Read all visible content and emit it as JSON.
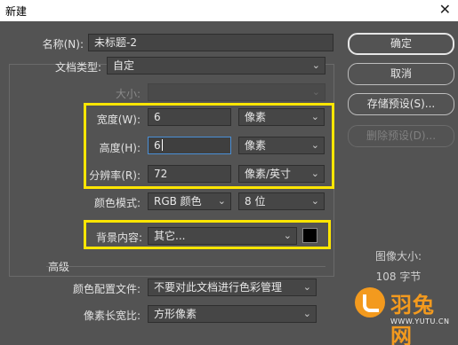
{
  "window": {
    "title": "新建",
    "close_glyph": "✕"
  },
  "form": {
    "name_label": "名称(N):",
    "name_value": "未标题-2",
    "doc_type_label": "文档类型:",
    "doc_type_value": "自定",
    "size_label": "大小:",
    "size_value": "",
    "width_label": "宽度(W):",
    "width_value": "6",
    "width_unit": "像素",
    "height_label": "高度(H):",
    "height_value": "6",
    "height_unit": "像素",
    "resolution_label": "分辨率(R):",
    "resolution_value": "72",
    "resolution_unit": "像素/英寸",
    "color_mode_label": "颜色模式:",
    "color_mode_value": "RGB 颜色",
    "bit_depth_value": "8 位",
    "background_label": "背景内容:",
    "background_value": "其它...",
    "background_color": "#000000",
    "advanced_label": "高级",
    "color_profile_label": "颜色配置文件:",
    "color_profile_value": "不要对此文档进行色彩管理",
    "pixel_aspect_label": "像素长宽比:",
    "pixel_aspect_value": "方形像素"
  },
  "buttons": {
    "ok": "确定",
    "cancel": "取消",
    "save_preset": "存储预设(S)...",
    "delete_preset": "删除预设(D)..."
  },
  "info": {
    "image_size_label": "图像大小:",
    "image_size_value": "108 字节"
  },
  "watermark": {
    "name": "羽兔网",
    "url": "WWW.YUTU.CN"
  },
  "colors": {
    "highlight": "#ffe600",
    "accent": "#4a8fd6",
    "watermark": "#f39a1e"
  },
  "icons": {
    "dropdown": "chevron-down-icon",
    "close": "close-icon"
  }
}
